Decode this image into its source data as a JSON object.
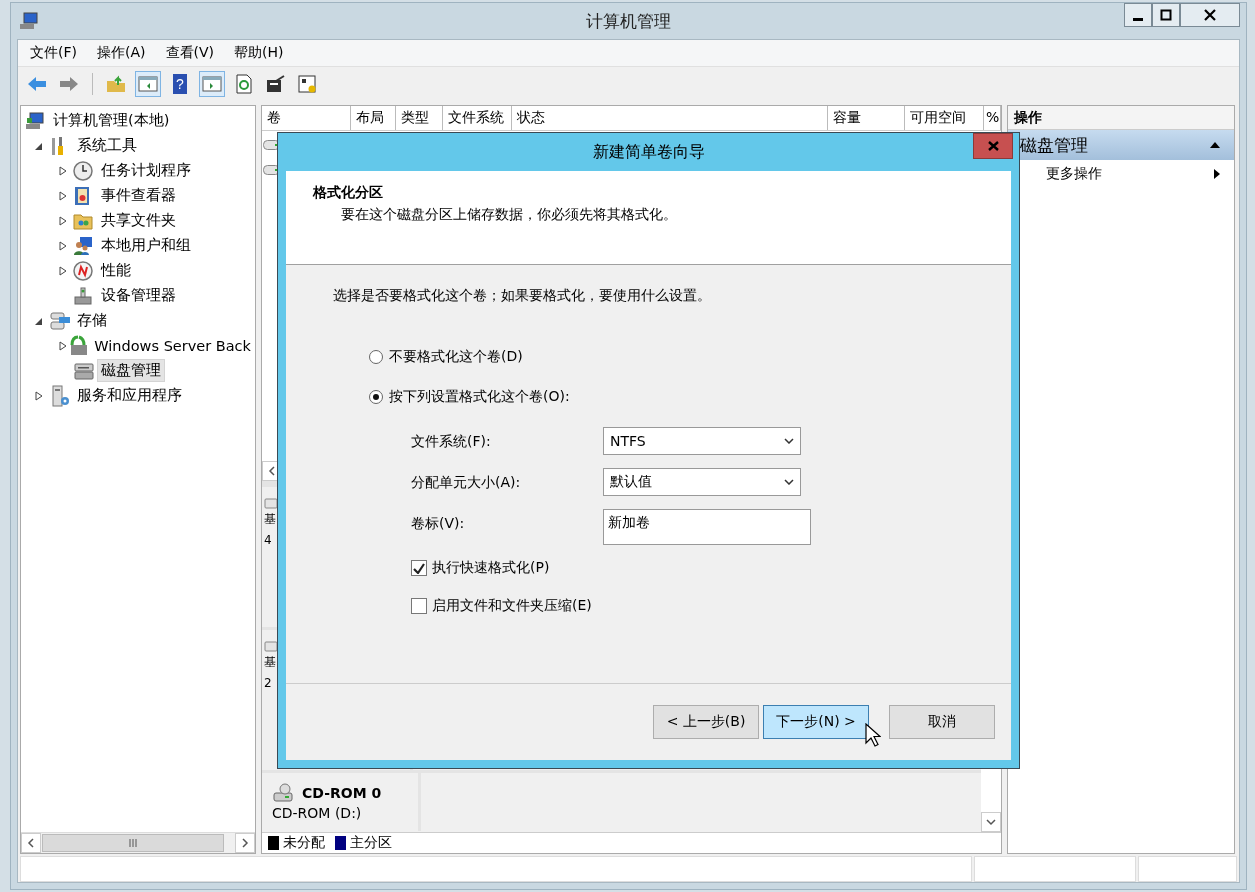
{
  "window": {
    "title": "计算机管理"
  },
  "menu": [
    {
      "label": "文件(F)"
    },
    {
      "label": "操作(A)"
    },
    {
      "label": "查看(V)"
    },
    {
      "label": "帮助(H)"
    }
  ],
  "tree": [
    {
      "label": "计算机管理(本地)",
      "selected": false,
      "children": [
        {
          "label": "系统工具",
          "expanded": true,
          "selected": false,
          "children": [
            {
              "label": "任务计划程序",
              "expanded": false,
              "selected": false
            },
            {
              "label": "事件查看器",
              "expanded": false,
              "selected": false
            },
            {
              "label": "共享文件夹",
              "expanded": false,
              "selected": false
            },
            {
              "label": "本地用户和组",
              "expanded": false,
              "selected": false
            },
            {
              "label": "性能",
              "expanded": false,
              "selected": false
            },
            {
              "label": "设备管理器",
              "selected": false
            }
          ]
        },
        {
          "label": "存储",
          "expanded": true,
          "selected": false,
          "children": [
            {
              "label": "Windows Server Back",
              "expanded": false,
              "selected": false
            },
            {
              "label": "磁盘管理",
              "selected": true
            }
          ]
        },
        {
          "label": "服务和应用程序",
          "expanded": false,
          "selected": false
        }
      ]
    }
  ],
  "volume_table": {
    "columns": [
      "卷",
      "布局",
      "类型",
      "文件系统",
      "状态",
      "容量",
      "可用空间",
      "%"
    ]
  },
  "toolbar": {
    "help_label": "?"
  },
  "disks": [
    {
      "kind": "disk",
      "lines": [
        "基",
        "4"
      ]
    },
    {
      "kind": "disk",
      "lines": [
        "基",
        "2"
      ]
    },
    {
      "kind": "cdrom",
      "name": "CD-ROM 0",
      "lines": [
        "CD-ROM (D:)"
      ]
    }
  ],
  "legend": [
    {
      "label": "未分配",
      "color": "#000000"
    },
    {
      "label": "主分区",
      "color": "#000080"
    }
  ],
  "actions": {
    "title": "操作",
    "groups": [
      {
        "label": "磁盘管理",
        "expanded": true,
        "items": [
          {
            "label": "更多操作"
          }
        ]
      }
    ]
  },
  "dialog": {
    "title": "新建简单卷向导",
    "heading": "格式化分区",
    "subheading": "要在这个磁盘分区上储存数据，你必须先将其格式化。",
    "prompt": "选择是否要格式化这个卷；如果要格式化，要使用什么设置。",
    "options": [
      {
        "label": "不要格式化这个卷(D)",
        "selected": false
      },
      {
        "label": "按下列设置格式化这个卷(O):",
        "selected": true
      }
    ],
    "fields": [
      {
        "kind": "dropdown",
        "label": "文件系统(F):",
        "value": "NTFS"
      },
      {
        "kind": "dropdown",
        "label": "分配单元大小(A):",
        "value": "默认值"
      },
      {
        "kind": "text",
        "label": "卷标(V):",
        "value": "新加卷"
      }
    ],
    "checks": [
      {
        "label": "执行快速格式化(P)",
        "checked": true
      },
      {
        "label": "启用文件和文件夹压缩(E)",
        "checked": false
      }
    ],
    "buttons": [
      {
        "label": "< 上一步(B)",
        "hovered": false
      },
      {
        "label": "下一步(N) >",
        "hovered": true
      },
      {
        "label": "取消",
        "hovered": false
      }
    ]
  }
}
